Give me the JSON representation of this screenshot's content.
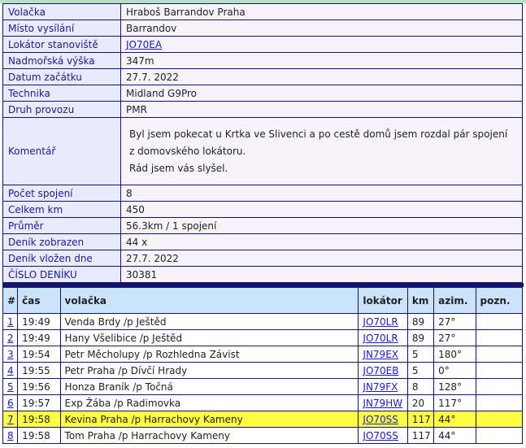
{
  "info": {
    "rows": [
      {
        "label": "Volačka",
        "value": "Hraboš Barrandov Praha"
      },
      {
        "label": "Místo vysílání",
        "value": "Barrandov"
      },
      {
        "label": "Lokátor stanoviště",
        "value": "JO70EA"
      },
      {
        "label": "Nadmořská výška",
        "value": "347m"
      },
      {
        "label": "Datum začátku",
        "value": "27.7. 2022"
      },
      {
        "label": "Technika",
        "value": "Midland G9Pro"
      },
      {
        "label": "Druh provozu",
        "value": "PMR"
      },
      {
        "label": "Komentář",
        "lines": [
          "Byl jsem pokecat u Krtka ve Slivenci a po cestě domů jsem rozdal pár spojení",
          "z domovského lokátoru.",
          "Rád jsem vás slyšel."
        ]
      },
      {
        "label": "Počet spojení",
        "value": "8"
      },
      {
        "label": "Celkem km",
        "value": "450"
      },
      {
        "label": "Průměr",
        "value": "56.3km / 1 spojení"
      },
      {
        "label": "Deník zobrazen",
        "value": "44 x"
      },
      {
        "label": "Deník vložen dne",
        "value": "27.7. 2022"
      },
      {
        "label": "ČÍSLO DENÍKU",
        "value": "30381"
      }
    ]
  },
  "log": {
    "headers": [
      "#",
      "čas",
      "volačka",
      "lokátor",
      "km",
      "azim.",
      "pozn."
    ],
    "rows": [
      {
        "num": "1",
        "time": "19:49",
        "call": "Venda Brdy /p Ještěd",
        "loc": "JO70LR",
        "km": "89",
        "azim": "27°",
        "note": "",
        "highlight": false
      },
      {
        "num": "2",
        "time": "19:49",
        "call": "Hany Všelibice /p Ještěd",
        "loc": "JO70LR",
        "km": "89",
        "azim": "27°",
        "note": "",
        "highlight": false
      },
      {
        "num": "3",
        "time": "19:54",
        "call": "Petr Měcholupy /p Rozhledna Závist",
        "loc": "JN79EX",
        "km": "5",
        "azim": "180°",
        "note": "",
        "highlight": false
      },
      {
        "num": "4",
        "time": "19:55",
        "call": "Petr Praha /p Dívčí Hrady",
        "loc": "JO70EB",
        "km": "5",
        "azim": "0°",
        "note": "",
        "highlight": false
      },
      {
        "num": "5",
        "time": "19:56",
        "call": "Honza Braník /p Točná",
        "loc": "JN79FX",
        "km": "8",
        "azim": "128°",
        "note": "",
        "highlight": false
      },
      {
        "num": "6",
        "time": "19:57",
        "call": "Exp Žába /p Radimovka",
        "loc": "JN79HW",
        "km": "20",
        "azim": "117°",
        "note": "",
        "highlight": false
      },
      {
        "num": "7",
        "time": "19:58",
        "call": "Kevina Praha /p Harrachovy Kameny",
        "loc": "JO70SS",
        "km": "117",
        "azim": "44°",
        "note": "",
        "highlight": true
      },
      {
        "num": "8",
        "time": "19:58",
        "call": "Tom Praha /p Harrachovy Kameny",
        "loc": "JO70SS",
        "km": "117",
        "azim": "44°",
        "note": "",
        "highlight": false
      }
    ]
  },
  "colors": {
    "border": "#14146e",
    "label_bg": "#eaeafd",
    "label_text": "#1a1a9a",
    "header_bg": "#cce4fb",
    "highlight": "#ffff44",
    "link": "#1a1ad0"
  }
}
